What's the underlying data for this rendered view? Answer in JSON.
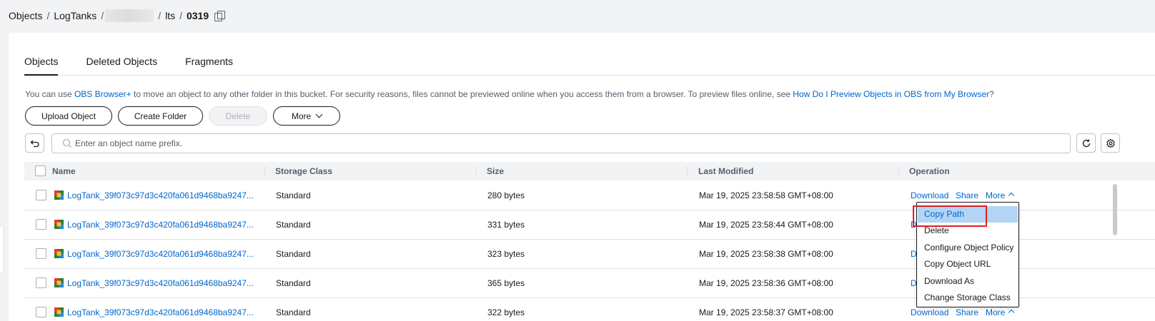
{
  "breadcrumb": {
    "items": [
      "Objects",
      "LogTanks",
      "lts",
      "0319"
    ],
    "separator": "/"
  },
  "tabs": [
    "Objects",
    "Deleted Objects",
    "Fragments"
  ],
  "info": {
    "prefix": "You can use ",
    "link1": "OBS Browser+",
    "middle": " to move an object to any other folder in this bucket. For security reasons, files cannot be previewed online when you access them from a browser. To preview files online, see ",
    "link2": "How Do I Preview Objects in OBS from My Browser",
    "suffix": "?"
  },
  "toolbar": {
    "upload": "Upload Object",
    "create_folder": "Create Folder",
    "delete": "Delete",
    "more": "More"
  },
  "search": {
    "placeholder": "Enter an object name prefix."
  },
  "table": {
    "headers": [
      "Name",
      "Storage Class",
      "Size",
      "Last Modified",
      "Operation"
    ],
    "rows": [
      {
        "name": "LogTank_39f073c97d3c420fa061d9468ba9247...",
        "storage": "Standard",
        "size": "280 bytes",
        "modified": "Mar 19, 2025 23:58:58 GMT+08:00"
      },
      {
        "name": "LogTank_39f073c97d3c420fa061d9468ba9247...",
        "storage": "Standard",
        "size": "331 bytes",
        "modified": "Mar 19, 2025 23:58:44 GMT+08:00"
      },
      {
        "name": "LogTank_39f073c97d3c420fa061d9468ba9247...",
        "storage": "Standard",
        "size": "323 bytes",
        "modified": "Mar 19, 2025 23:58:38 GMT+08:00"
      },
      {
        "name": "LogTank_39f073c97d3c420fa061d9468ba9247...",
        "storage": "Standard",
        "size": "365 bytes",
        "modified": "Mar 19, 2025 23:58:36 GMT+08:00"
      },
      {
        "name": "LogTank_39f073c97d3c420fa061d9468ba9247...",
        "storage": "Standard",
        "size": "322 bytes",
        "modified": "Mar 19, 2025 23:58:37 GMT+08:00"
      }
    ],
    "operations": {
      "download": "Download",
      "share": "Share",
      "more": "More",
      "truncated": "D"
    }
  },
  "dropdown": {
    "items": [
      "Copy Path",
      "Delete",
      "Configure Object Policy",
      "Copy Object URL",
      "Download As",
      "Change Storage Class"
    ],
    "hovered": "Copy Path"
  },
  "colors": {
    "link": "#0066cc",
    "highlight": "#e02020",
    "hover": "#b3d4f5"
  }
}
